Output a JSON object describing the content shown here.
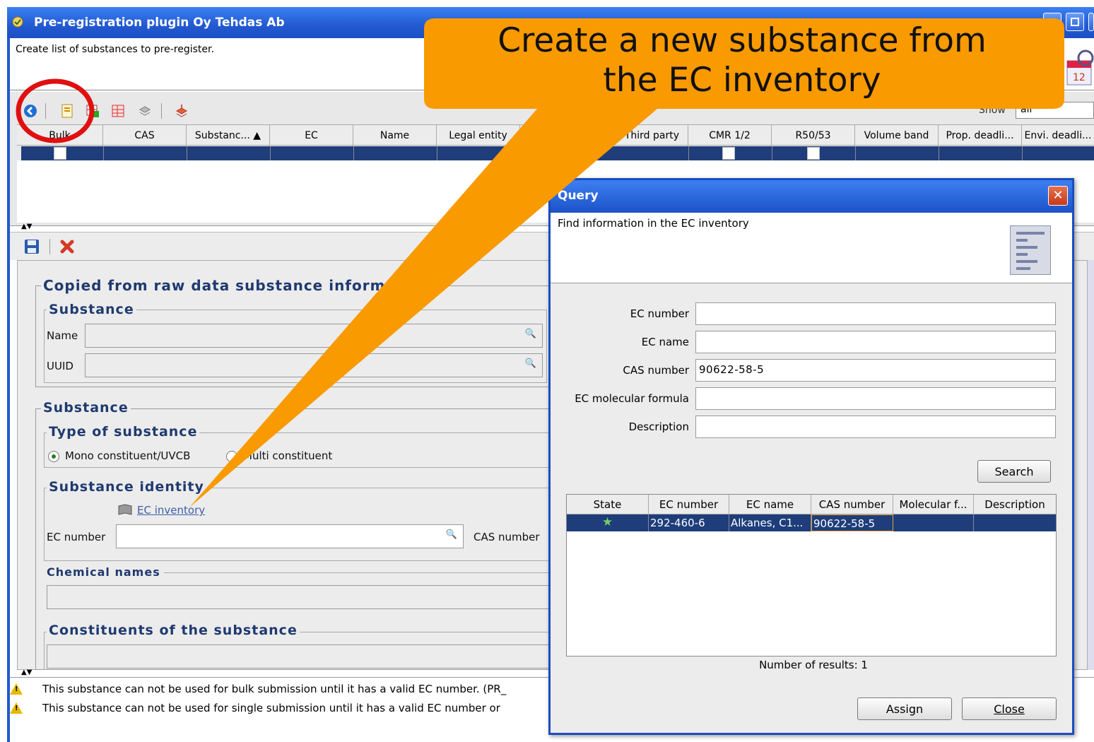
{
  "window": {
    "title": "Pre-registration plugin Oy Tehdas Ab",
    "subtitle": "Create list of substances to pre-register."
  },
  "toolbar": {
    "show_label": "Show",
    "show_value": "all"
  },
  "grid": {
    "columns": [
      "Bulk",
      "CAS",
      "Substanc... ▲",
      "EC",
      "Name",
      "Legal entity",
      "",
      "Third party",
      "CMR 1/2",
      "R50/53",
      "Volume band",
      "Prop. deadli...",
      "Envi. deadli..."
    ]
  },
  "detail": {
    "copied_group": "Copied from raw data substance inform",
    "substance_sub": "Substance",
    "name_label": "Name",
    "uuid_label": "UUID",
    "substance_group": "Substance",
    "type_group": "Type of substance",
    "mono_label": "Mono constituent/UVCB",
    "multi_label": "Multi constituent",
    "identity_group": "Substance identity",
    "ec_inventory_link": "EC inventory",
    "ec_number_label": "EC number",
    "cas_number_label": "CAS number",
    "chemical_names_label": "Chemical names",
    "constituents_group": "Constituents of the substance"
  },
  "warnings": [
    "This substance can not be used for bulk submission until it has a valid EC number. (PR_",
    "This substance can not be used for single submission until it has a valid EC number or"
  ],
  "dialog": {
    "title": "Query",
    "description": "Find information in the EC inventory",
    "fields": [
      {
        "label": "EC number",
        "value": ""
      },
      {
        "label": "EC name",
        "value": ""
      },
      {
        "label": "CAS number",
        "value": "90622-58-5"
      },
      {
        "label": "EC molecular formula",
        "value": ""
      },
      {
        "label": "Description",
        "value": ""
      }
    ],
    "search_button": "Search",
    "result_columns": [
      "State",
      "EC number",
      "EC name",
      "CAS number",
      "Molecular f...",
      "Description"
    ],
    "result_row": {
      "state": "★",
      "ec_number": "292-460-6",
      "ec_name": "Alkanes, C1...",
      "cas_number": "90622-58-5",
      "molecular": "",
      "description": ""
    },
    "number_of_results": "Number of results: 1",
    "assign_button": "Assign",
    "close_button": "Close"
  },
  "callout": {
    "text_line1": "Create a new substance from",
    "text_line2": "the EC inventory",
    "fill_color": "#f89a00"
  }
}
